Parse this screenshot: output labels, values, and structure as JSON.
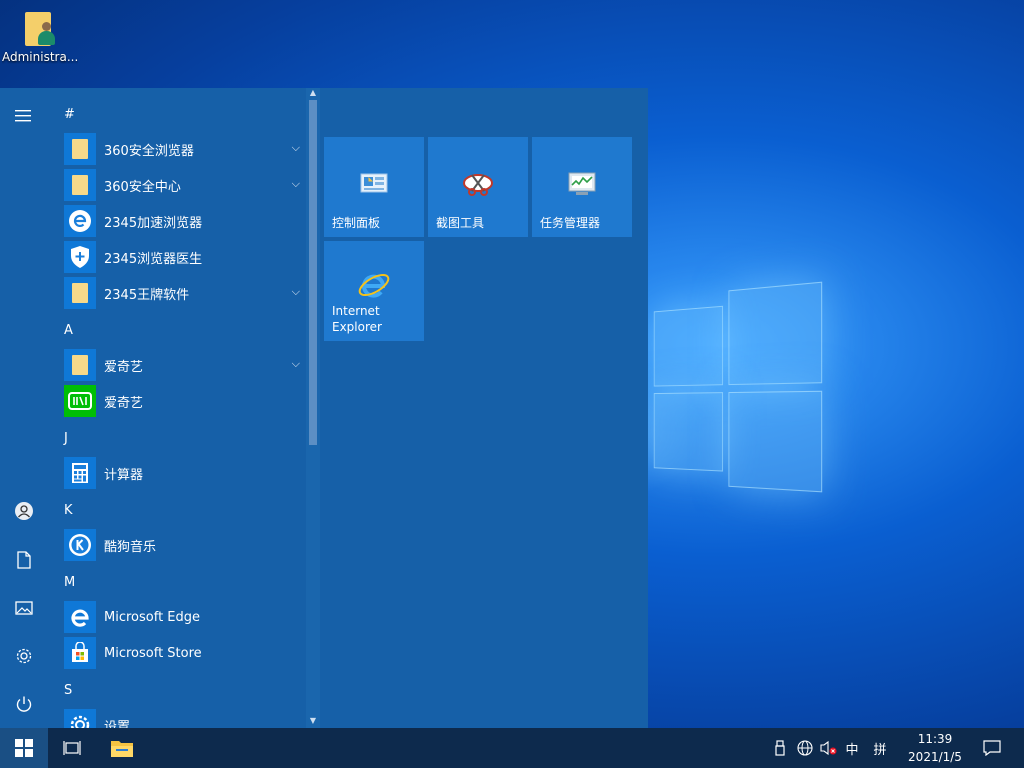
{
  "desktop": {
    "icon_label": "Administra..."
  },
  "start_menu": {
    "sections": [
      {
        "letter": "#",
        "apps": [
          {
            "name": "360安全浏览器",
            "icon": "folder-icon",
            "expandable": true
          },
          {
            "name": "360安全中心",
            "icon": "folder-icon",
            "expandable": true
          },
          {
            "name": "2345加速浏览器",
            "icon": "browser-e-icon",
            "expandable": false
          },
          {
            "name": "2345浏览器医生",
            "icon": "shield-plus-icon",
            "expandable": false
          },
          {
            "name": "2345王牌软件",
            "icon": "folder-icon",
            "expandable": true
          }
        ]
      },
      {
        "letter": "A",
        "apps": [
          {
            "name": "爱奇艺",
            "icon": "folder-icon",
            "expandable": true
          },
          {
            "name": "爱奇艺",
            "icon": "iqiyi-icon",
            "expandable": false
          }
        ]
      },
      {
        "letter": "J",
        "apps": [
          {
            "name": "计算器",
            "icon": "calculator-icon",
            "expandable": false
          }
        ]
      },
      {
        "letter": "K",
        "apps": [
          {
            "name": "酷狗音乐",
            "icon": "kugou-icon",
            "expandable": false
          }
        ]
      },
      {
        "letter": "M",
        "apps": [
          {
            "name": "Microsoft Edge",
            "icon": "edge-icon",
            "expandable": false
          },
          {
            "name": "Microsoft Store",
            "icon": "store-icon",
            "expandable": false
          }
        ]
      },
      {
        "letter": "S",
        "apps": [
          {
            "name": "设置",
            "icon": "gear-icon",
            "expandable": false
          }
        ]
      }
    ],
    "tiles": [
      {
        "label": "控制面板",
        "icon": "control-panel-icon"
      },
      {
        "label": "截图工具",
        "icon": "snipping-tool-icon"
      },
      {
        "label": "任务管理器",
        "icon": "task-manager-icon"
      },
      {
        "label_line1": "Internet",
        "label_line2": "Explorer",
        "icon": "internet-explorer-icon"
      }
    ]
  },
  "taskbar": {
    "ime_lang": "中",
    "ime_mode": "拼",
    "time": "11:39",
    "date": "2021/1/5"
  },
  "colors": {
    "start_bg": "#1660a8",
    "tile_bg": "#1f79cf",
    "taskbar_bg": "#0d2a4d"
  }
}
